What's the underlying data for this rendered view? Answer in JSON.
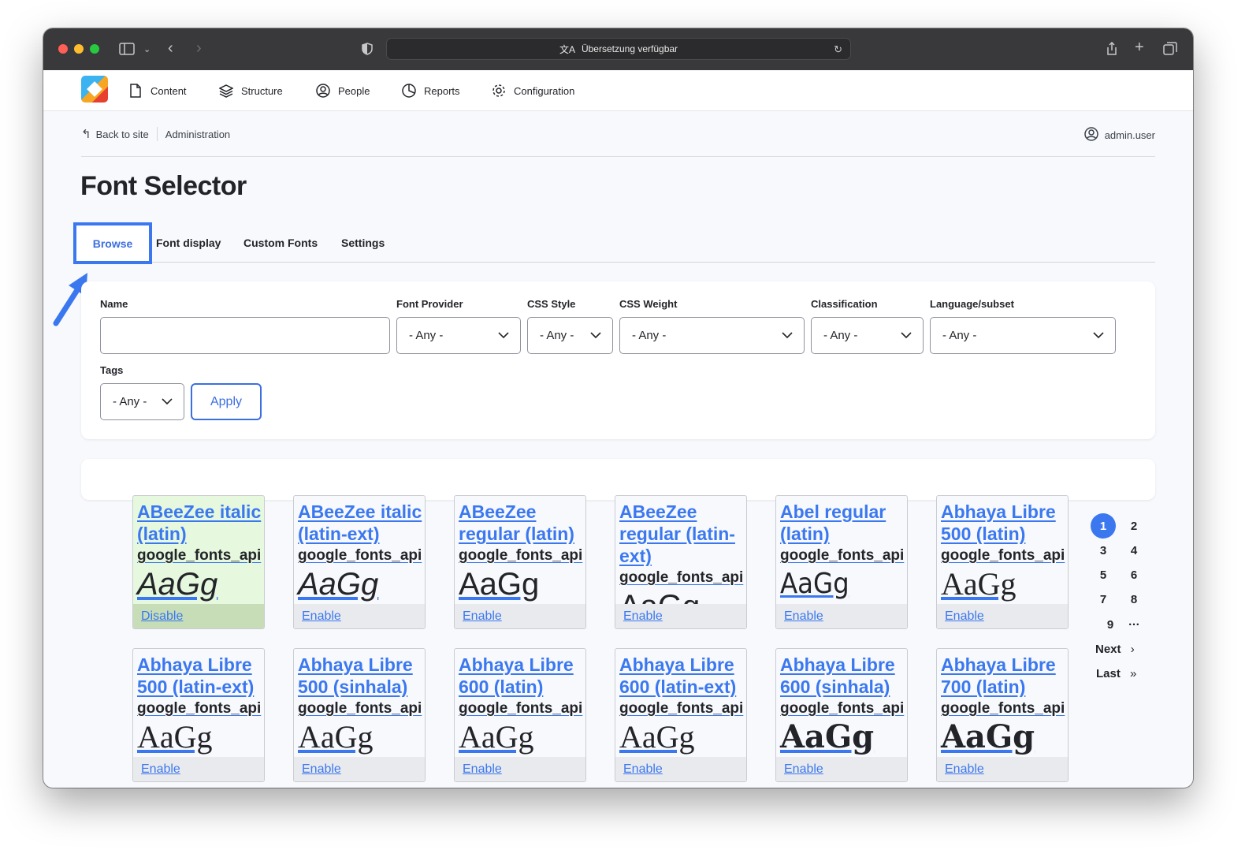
{
  "browser": {
    "url_text": "Übersetzung verfügbar"
  },
  "toolbar": {
    "nav": [
      {
        "label": "Content",
        "icon": "file-icon"
      },
      {
        "label": "Structure",
        "icon": "layers-icon"
      },
      {
        "label": "People",
        "icon": "user-circle-icon"
      },
      {
        "label": "Reports",
        "icon": "pie-chart-icon"
      },
      {
        "label": "Configuration",
        "icon": "gear-icon"
      }
    ]
  },
  "breadcrumb": {
    "back": "Back to site",
    "current": "Administration"
  },
  "user": {
    "name": "admin.user"
  },
  "page": {
    "title": "Font Selector"
  },
  "tabs": [
    "Browse",
    "Font display",
    "Custom Fonts",
    "Settings"
  ],
  "filters": {
    "name_label": "Name",
    "name_value": "",
    "provider_label": "Font Provider",
    "provider_value": "- Any -",
    "style_label": "CSS Style",
    "style_value": "- Any -",
    "weight_label": "CSS Weight",
    "weight_value": "- Any -",
    "classification_label": "Classification",
    "classification_value": "- Any -",
    "language_label": "Language/subset",
    "language_value": "- Any -",
    "tags_label": "Tags",
    "tags_value": "- Any -",
    "apply_label": "Apply"
  },
  "fonts": [
    {
      "name": "ABeeZee italic (latin)",
      "provider": "google_fonts_api",
      "sample": "AaGg",
      "action": "Disable",
      "enabled": true
    },
    {
      "name": "ABeeZee italic (latin-ext)",
      "provider": "google_fonts_api",
      "sample": "AaGg",
      "action": "Enable",
      "enabled": false
    },
    {
      "name": "ABeeZee regular (latin)",
      "provider": "google_fonts_api",
      "sample": "AaGg",
      "action": "Enable",
      "enabled": false
    },
    {
      "name": "ABeeZee regular (latin-ext)",
      "provider": "google_fonts_api",
      "sample": "AaGg",
      "action": "Enable",
      "enabled": false
    },
    {
      "name": "Abel regular (latin)",
      "provider": "google_fonts_api",
      "sample": "AaGg",
      "action": "Enable",
      "enabled": false
    },
    {
      "name": "Abhaya Libre 500 (latin)",
      "provider": "google_fonts_api",
      "sample": "AaGg",
      "action": "Enable",
      "enabled": false
    },
    {
      "name": "Abhaya Libre 500 (latin-ext)",
      "provider": "google_fonts_api",
      "sample": "AaGg",
      "action": "Enable",
      "enabled": false
    },
    {
      "name": "Abhaya Libre 500 (sinhala)",
      "provider": "google_fonts_api",
      "sample": "AaGg",
      "action": "Enable",
      "enabled": false
    },
    {
      "name": "Abhaya Libre 600 (latin)",
      "provider": "google_fonts_api",
      "sample": "AaGg",
      "action": "Enable",
      "enabled": false
    },
    {
      "name": "Abhaya Libre 600 (latin-ext)",
      "provider": "google_fonts_api",
      "sample": "AaGg",
      "action": "Enable",
      "enabled": false
    },
    {
      "name": "Abhaya Libre 600 (sinhala)",
      "provider": "google_fonts_api",
      "sample": "AaGg",
      "action": "Enable",
      "enabled": false
    },
    {
      "name": "Abhaya Libre 700 (latin)",
      "provider": "google_fonts_api",
      "sample": "AaGg",
      "action": "Enable",
      "enabled": false
    }
  ],
  "pager": {
    "pages": [
      "1",
      "2",
      "3",
      "4",
      "5",
      "6",
      "7",
      "8",
      "9"
    ],
    "current": "1",
    "ellipsis": "…",
    "next": "Next",
    "next_icon": "›",
    "last": "Last",
    "last_icon": "»"
  },
  "colors": {
    "accent": "#3b78f0",
    "enabled_card": "#e6f9de",
    "annotation": "#3b78f0"
  }
}
